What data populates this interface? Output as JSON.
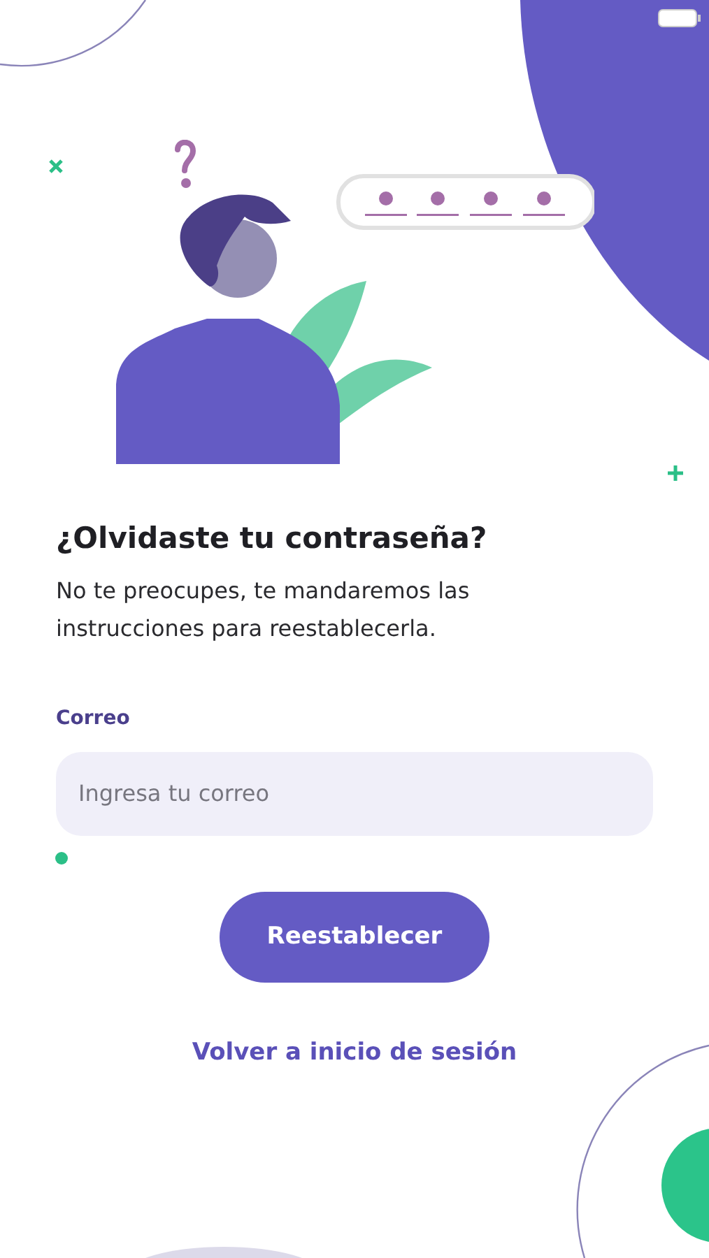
{
  "title": "¿Olvidaste tu contraseña?",
  "description": "No te preocupes, te mandaremos las instrucciones para reestablecerla.",
  "email_field": {
    "label": "Correo",
    "placeholder": "Ingresa tu correo"
  },
  "submit_button": "Reestablecer",
  "back_link": "Volver a inicio de sesión"
}
